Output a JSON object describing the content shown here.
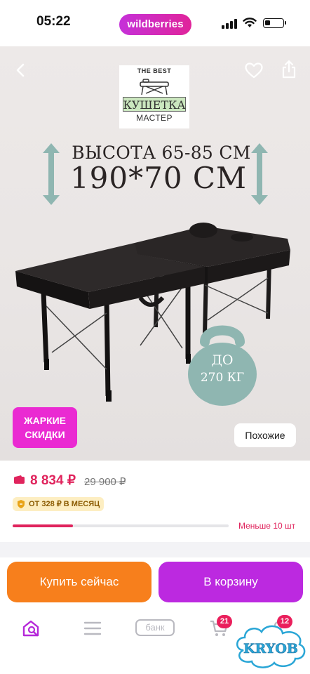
{
  "status_bar": {
    "time": "05:22",
    "app_name": "wildberries",
    "battery_level": 0.3
  },
  "product_image": {
    "logo": {
      "tagline": "THE BEST",
      "word1": "КУШЕТКА",
      "word2": "МАСТЕР"
    },
    "headline_line1": "ВЫСОТА 65-85 СМ",
    "headline_line2": "190*70 СМ",
    "weight_line1": "ДО",
    "weight_line2": "270 КГ",
    "hot_badge_line1": "ЖАРКИЕ",
    "hot_badge_line2": "СКИДКИ",
    "similar_label": "Похожие",
    "icons": [
      "back-arrow-icon",
      "heart-icon",
      "share-icon"
    ]
  },
  "pricing": {
    "price": "8 834 ₽",
    "old_price": "29 900 ₽",
    "installment": "ОТ 328 ₽ В МЕСЯЦ",
    "stock_label": "Меньше 10 шт",
    "stock_fraction": 0.28
  },
  "actions": {
    "buy_now": "Купить сейчас",
    "add_to_cart": "В корзину"
  },
  "tabbar": {
    "bank_label": "банк",
    "cart_count": "21",
    "profile_count": "12",
    "icons": [
      "search-home-icon",
      "menu-icon",
      "bank-icon",
      "cart-icon",
      "profile-icon"
    ]
  },
  "watermark_text": "KRYOB",
  "colors": {
    "brand_magenta": "#c531d9",
    "price_red": "#e0245d",
    "buy_orange": "#f77f1c",
    "cart_purple": "#bc29e0",
    "hot_pink": "#ea2ad2"
  }
}
